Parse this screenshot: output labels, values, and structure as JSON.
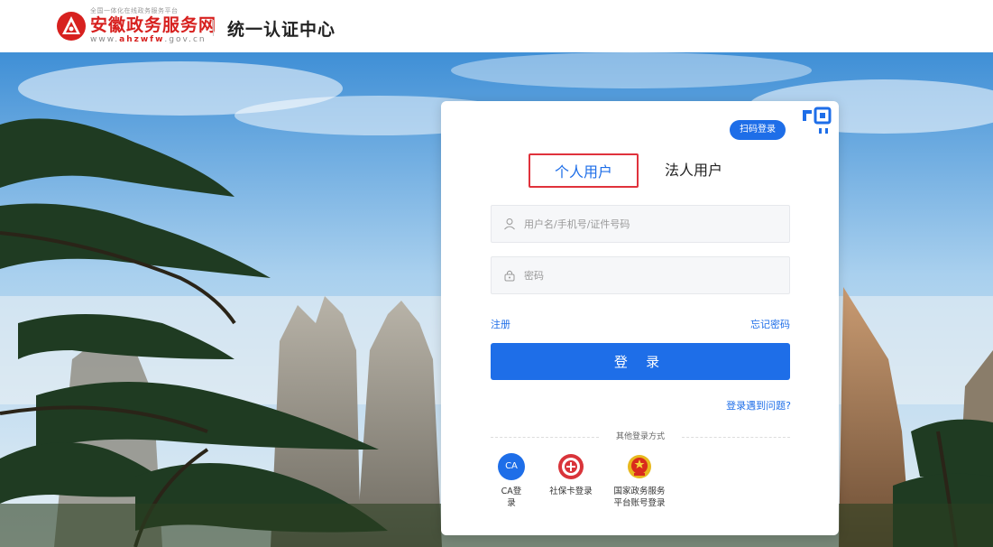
{
  "header": {
    "logo_tagline": "全国一体化在线政务服务平台",
    "logo_name": "安徽政务服务网",
    "logo_url_prefix": "www.",
    "logo_url_domain": "ahzwfw",
    "logo_url_suffix": ".gov.cn",
    "title": "统一认证中心"
  },
  "card": {
    "qr_button_label": "扫码登录",
    "tabs": [
      {
        "label": "个人用户",
        "active": true
      },
      {
        "label": "法人用户",
        "active": false
      }
    ],
    "username_placeholder": "用户名/手机号/证件号码",
    "password_placeholder": "密码",
    "register_label": "注册",
    "forgot_label": "忘记密码",
    "login_label": "登 录",
    "problem_label": "登录遇到问题?",
    "other_methods_label": "其他登录方式",
    "ca_icon_text": "CA",
    "alt_methods": [
      {
        "label": "CA登录",
        "icon": "ca-icon"
      },
      {
        "label": "社保卡登录",
        "icon": "social-security-card-icon"
      },
      {
        "label_line1": "国家政务服务",
        "label_line2": "平台账号登录",
        "icon": "national-emblem-icon"
      }
    ]
  },
  "colors": {
    "primary": "#1e6ee8",
    "brand_red": "#d7211f",
    "tab_highlight_border": "#e0323c"
  }
}
